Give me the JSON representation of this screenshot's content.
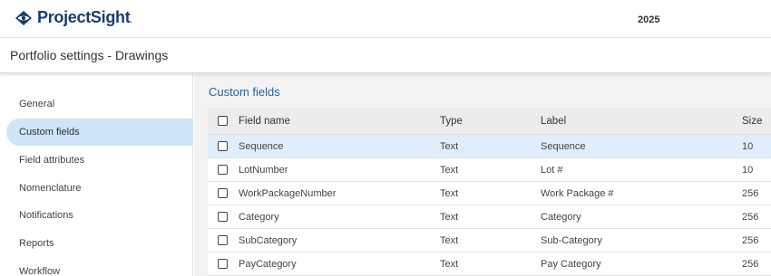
{
  "header": {
    "brand": "ProjectSight",
    "trademark": ".",
    "year": "2025"
  },
  "page_title": "Portfolio settings - Drawings",
  "sidebar": {
    "items": [
      {
        "label": "General"
      },
      {
        "label": "Custom fields",
        "active": true
      },
      {
        "label": "Field attributes"
      },
      {
        "label": "Nomenclature"
      },
      {
        "label": "Notifications"
      },
      {
        "label": "Reports"
      },
      {
        "label": "Workflow"
      }
    ]
  },
  "main": {
    "section_title": "Custom fields",
    "table": {
      "columns": {
        "name": "Field name",
        "type": "Type",
        "label": "Label",
        "size": "Size"
      },
      "rows": [
        {
          "name": "Sequence",
          "type": "Text",
          "label": "Sequence",
          "size": "10",
          "selected": true
        },
        {
          "name": "LotNumber",
          "type": "Text",
          "label": "Lot #",
          "size": "10"
        },
        {
          "name": "WorkPackageNumber",
          "type": "Text",
          "label": "Work Package #",
          "size": "256"
        },
        {
          "name": "Category",
          "type": "Text",
          "label": "Category",
          "size": "256"
        },
        {
          "name": "SubCategory",
          "type": "Text",
          "label": "Sub-Category",
          "size": "256"
        },
        {
          "name": "PayCategory",
          "type": "Text",
          "label": "Pay Category",
          "size": "256"
        }
      ]
    }
  },
  "colors": {
    "brand": "#1a3d6d",
    "accent": "#2a6496",
    "active_nav": "#cfe4f7",
    "selected_row": "#dfeefa"
  },
  "icons": {
    "logo": "projectsight-logo-icon",
    "checkbox": "checkbox-icon"
  }
}
